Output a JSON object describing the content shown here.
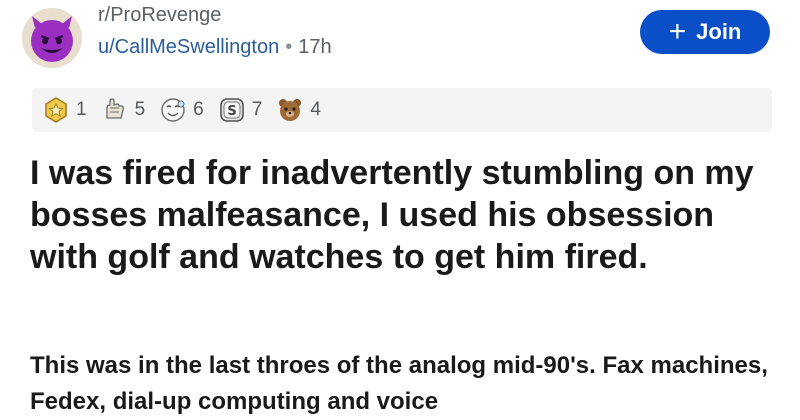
{
  "header": {
    "subreddit": "r/ProRevenge",
    "username": "u/CallMeSwellington",
    "separator": "•",
    "time_ago": "17h",
    "join_label": "Join",
    "join_color": "#0a4fc7"
  },
  "awards": [
    {
      "icon": "medal-award-icon",
      "count": "1"
    },
    {
      "icon": "hand-award-icon",
      "count": "5"
    },
    {
      "icon": "face-award-icon",
      "count": "6"
    },
    {
      "icon": "silver-coin-award-icon",
      "count": "7"
    },
    {
      "icon": "bear-award-icon",
      "count": "4"
    }
  ],
  "post": {
    "title": "I was fired for inadvertently stumbling on my bosses malfeasance, I used his obsession with golf and watches to get him fired.",
    "body": "This was in the last throes of the analog mid-90's. Fax machines, Fedex, dial-up computing and voice"
  }
}
